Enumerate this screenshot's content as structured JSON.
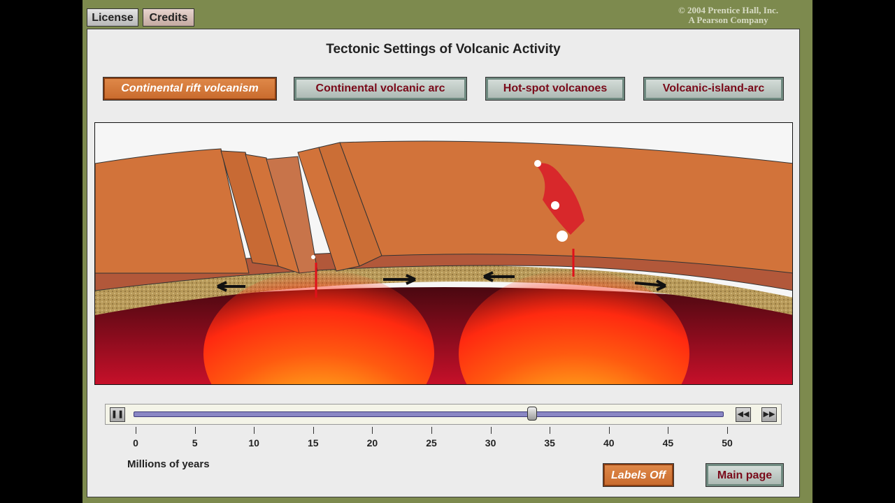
{
  "top_buttons": {
    "license": "License",
    "credits": "Credits"
  },
  "copyright": {
    "line1": "© 2004 Prentice Hall, Inc.",
    "line2": "A Pearson Company"
  },
  "title": "Tectonic Settings of Volcanic Activity",
  "tabs": [
    {
      "label": "Continental rift volcanism",
      "active": true
    },
    {
      "label": "Continental volcanic arc",
      "active": false
    },
    {
      "label": "Hot-spot volcanoes",
      "active": false
    },
    {
      "label": "Volcanic-island-arc",
      "active": false
    }
  ],
  "timeline": {
    "ticks": [
      "0",
      "5",
      "10",
      "15",
      "20",
      "25",
      "30",
      "35",
      "40",
      "45",
      "50"
    ],
    "axis_label": "Millions of years",
    "current_value": 33.5
  },
  "bottom_buttons": {
    "labels_toggle": "Labels Off",
    "main_page": "Main page"
  },
  "colors": {
    "crust": "#d2733a",
    "mantle": "#8a0f1a",
    "magma": "#ff2a00",
    "frame": "#7d8a4e"
  }
}
